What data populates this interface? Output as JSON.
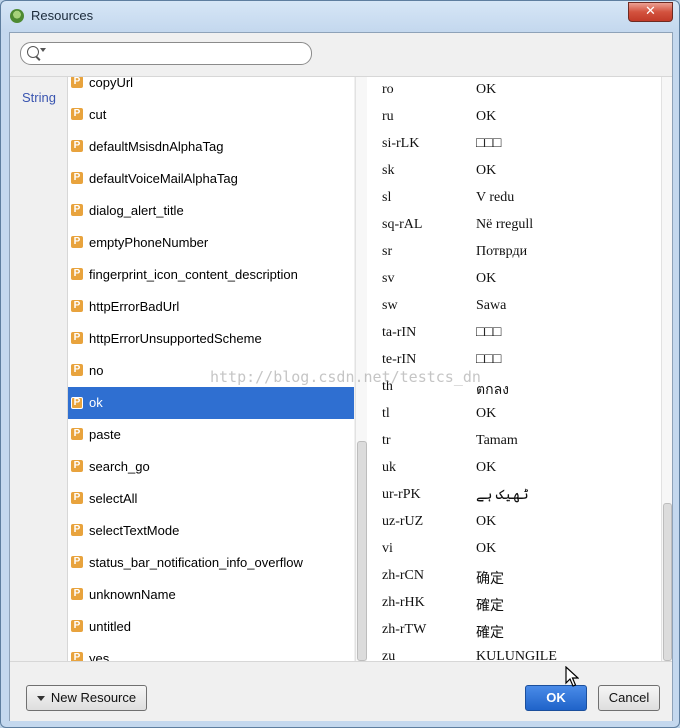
{
  "window": {
    "title": "Resources",
    "close_symbol": "✕"
  },
  "search": {
    "value": "",
    "placeholder": ""
  },
  "category": "String",
  "resource_badge": "P",
  "resources": [
    {
      "name": "copyUrl"
    },
    {
      "name": "cut"
    },
    {
      "name": "defaultMsisdnAlphaTag"
    },
    {
      "name": "defaultVoiceMailAlphaTag"
    },
    {
      "name": "dialog_alert_title"
    },
    {
      "name": "emptyPhoneNumber"
    },
    {
      "name": "fingerprint_icon_content_description"
    },
    {
      "name": "httpErrorBadUrl"
    },
    {
      "name": "httpErrorUnsupportedScheme"
    },
    {
      "name": "no"
    },
    {
      "name": "ok",
      "selected": true
    },
    {
      "name": "paste"
    },
    {
      "name": "search_go"
    },
    {
      "name": "selectAll"
    },
    {
      "name": "selectTextMode"
    },
    {
      "name": "status_bar_notification_info_overflow"
    },
    {
      "name": "unknownName"
    },
    {
      "name": "untitled"
    },
    {
      "name": "yes"
    }
  ],
  "translations": [
    {
      "locale": "ro",
      "value": "OK"
    },
    {
      "locale": "ru",
      "value": "OK"
    },
    {
      "locale": "si-rLK",
      "value": "□□□"
    },
    {
      "locale": "sk",
      "value": "OK"
    },
    {
      "locale": "sl",
      "value": "V redu"
    },
    {
      "locale": "sq-rAL",
      "value": "Në rregull"
    },
    {
      "locale": "sr",
      "value": "Потврди"
    },
    {
      "locale": "sv",
      "value": "OK"
    },
    {
      "locale": "sw",
      "value": "Sawa"
    },
    {
      "locale": "ta-rIN",
      "value": "□□□"
    },
    {
      "locale": "te-rIN",
      "value": "□□□"
    },
    {
      "locale": "th",
      "value": "ตกลง"
    },
    {
      "locale": "tl",
      "value": "OK"
    },
    {
      "locale": "tr",
      "value": "Tamam"
    },
    {
      "locale": "uk",
      "value": "OK"
    },
    {
      "locale": "ur-rPK",
      "value": "ٹھیک ہے"
    },
    {
      "locale": "uz-rUZ",
      "value": "OK"
    },
    {
      "locale": "vi",
      "value": "OK"
    },
    {
      "locale": "zh-rCN",
      "value": "确定"
    },
    {
      "locale": "zh-rHK",
      "value": "確定"
    },
    {
      "locale": "zh-rTW",
      "value": "確定"
    },
    {
      "locale": "zu",
      "value": "KULUNGILE"
    }
  ],
  "watermark": "http://blog.csdn.net/testcs_dn",
  "buttons": {
    "new_resource": "New Resource",
    "ok": "OK",
    "cancel": "Cancel"
  },
  "colors": {
    "selection": "#2f6fd1",
    "badge": "#e8a33d",
    "category_link": "#3a55b0"
  }
}
